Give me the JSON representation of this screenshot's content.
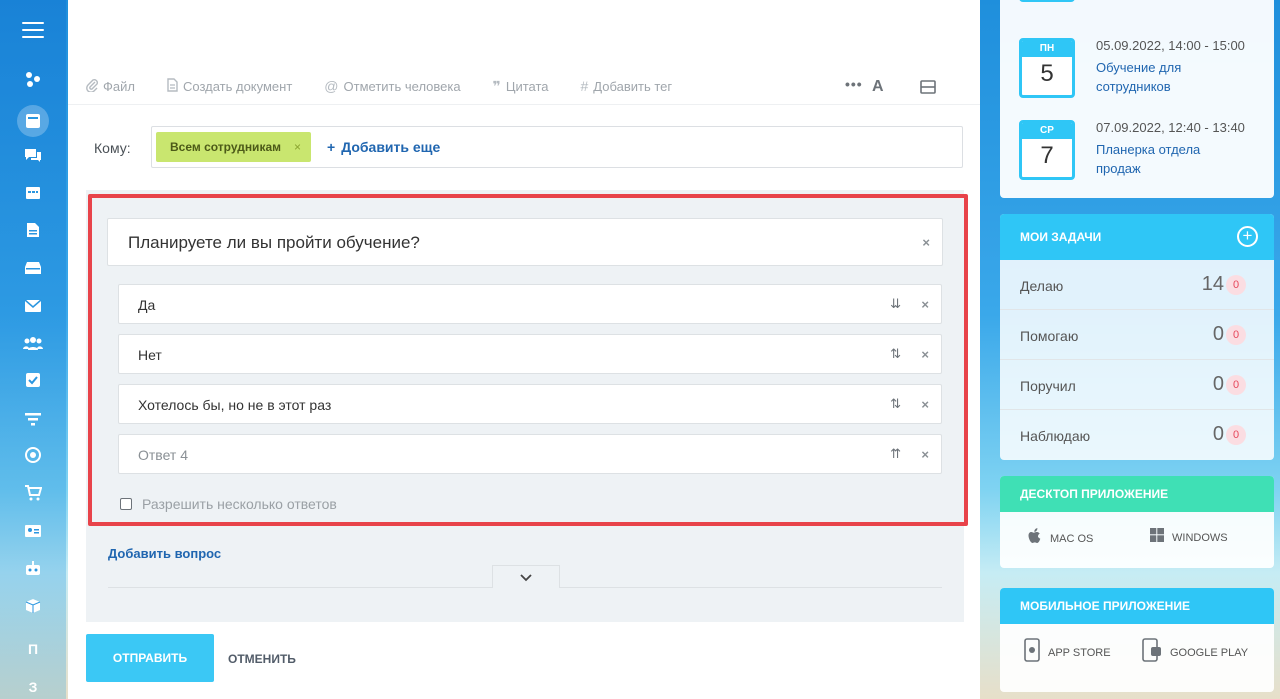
{
  "left_nav": {
    "letters": [
      "П",
      "З"
    ]
  },
  "toolbar": {
    "items": [
      {
        "icon": "paperclip-icon",
        "label": "Файл"
      },
      {
        "icon": "document-icon",
        "label": "Создать документ"
      },
      {
        "icon": "at-icon",
        "label": "Отметить человека"
      },
      {
        "icon": "quote-icon",
        "label": "Цитата"
      },
      {
        "icon": "hash-icon",
        "label": "Добавить тег"
      }
    ],
    "more": "•••",
    "font": "A"
  },
  "recipients": {
    "label": "Кому:",
    "tag": "Всем сотрудникам",
    "tag_remove": "×",
    "add_more": "Добавить еще"
  },
  "poll": {
    "question": "Планируете ли вы пройти обучение?",
    "answers": [
      {
        "text": "Да",
        "sort": "⇊"
      },
      {
        "text": "Нет",
        "sort": "⇅"
      },
      {
        "text": "Хотелось бы, но не в этот раз",
        "sort": "⇅"
      }
    ],
    "answer_placeholder": "Ответ  4",
    "placeholder_sort": "⇈",
    "remove": "×",
    "allow_multiple": "Разрешить несколько ответов",
    "add_question": "Добавить вопрос",
    "collapse": "⌄"
  },
  "actions": {
    "send": "ОТПРАВИТЬ",
    "cancel": "ОТМЕНИТЬ"
  },
  "calendar": {
    "events": [
      {
        "dow": "ПН",
        "day": "5",
        "time": "05.09.2022, 14:00 - 15:00",
        "title": "Обучение для сотрудников"
      },
      {
        "dow": "СР",
        "day": "7",
        "time": "07.09.2022, 12:40 - 13:40",
        "title": "Планерка отдела продаж"
      }
    ]
  },
  "tasks": {
    "title": "МОИ ЗАДАЧИ",
    "rows": [
      {
        "label": "Делаю",
        "count": "14",
        "badge": "0"
      },
      {
        "label": "Помогаю",
        "count": "0",
        "badge": "0"
      },
      {
        "label": "Поручил",
        "count": "0",
        "badge": "0"
      },
      {
        "label": "Наблюдаю",
        "count": "0",
        "badge": "0"
      }
    ]
  },
  "desktop_app": {
    "title": "ДЕСКТОП ПРИЛОЖЕНИЕ",
    "mac": "MAC OS",
    "windows": "WINDOWS",
    "color": "#3fe0b5"
  },
  "mobile_app": {
    "title": "МОБИЛЬНОЕ ПРИЛОЖЕНИЕ",
    "ios": "APP STORE",
    "android": "GOOGLE PLAY",
    "color": "#2fc6f6"
  }
}
